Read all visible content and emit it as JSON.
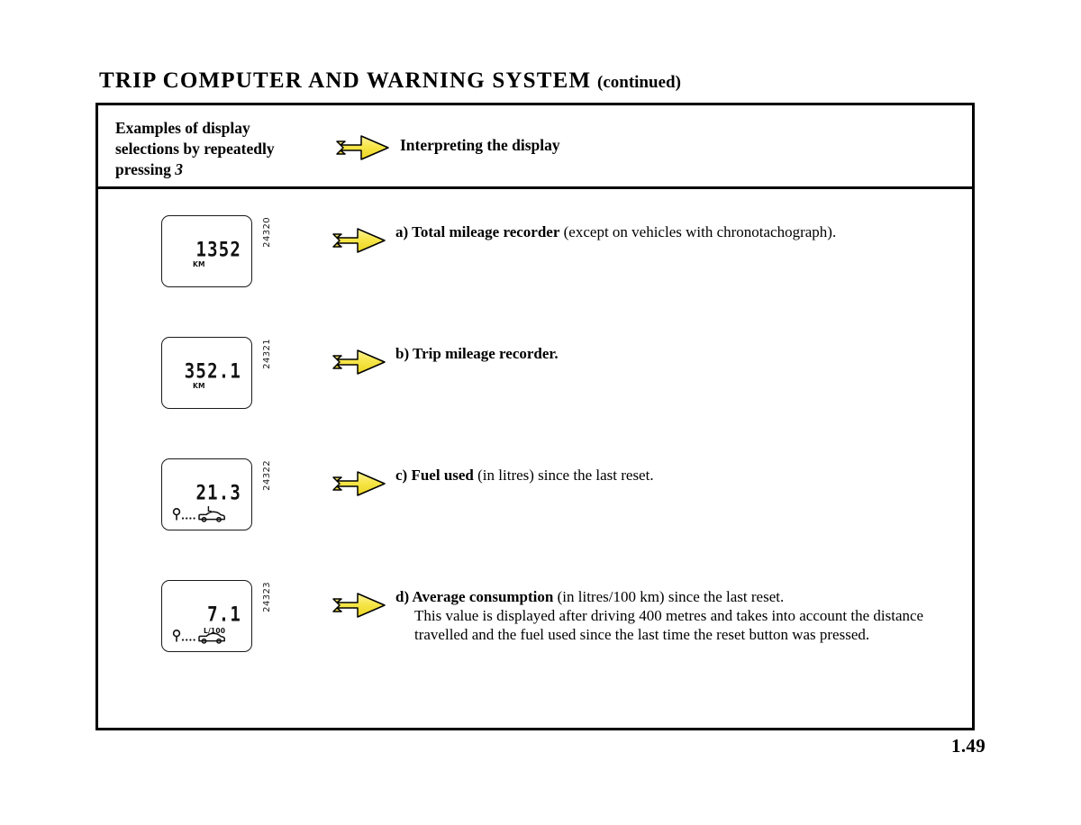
{
  "page": {
    "title_main": "TRIP COMPUTER AND WARNING SYSTEM",
    "title_continued": "(continued)",
    "number": "1.49"
  },
  "header": {
    "left_label_line1": "Examples of display",
    "left_label_line2": "selections by repeatedly",
    "left_label_line3_prefix": "pressing",
    "left_label_button_ref": "3",
    "arrow_icon": "yellow-right-arrow-icon",
    "right_label": "Interpreting the display"
  },
  "entries": [
    {
      "ref": "24320",
      "display": {
        "value": "1352",
        "unit": "KM",
        "unit_class": "unit-km",
        "pictogram": false
      },
      "arrow_icon": "yellow-right-arrow-icon",
      "lead": "a) Total mileage recorder",
      "tail": " (except on vehicles with chronotachograph).",
      "extra": ""
    },
    {
      "ref": "24321",
      "display": {
        "value": "352.1",
        "unit": "KM",
        "unit_class": "unit-km",
        "pictogram": false
      },
      "arrow_icon": "yellow-right-arrow-icon",
      "lead": "b) Trip mileage recorder.",
      "tail": "",
      "extra": ""
    },
    {
      "ref": "24322",
      "display": {
        "value": "21.3",
        "unit": "L",
        "unit_class": "unit-l",
        "pictogram": true
      },
      "arrow_icon": "yellow-right-arrow-icon",
      "lead": "c) Fuel used",
      "tail": " (in litres) since the last reset.",
      "extra": ""
    },
    {
      "ref": "24323",
      "display": {
        "value": "7.1",
        "unit": "L/100",
        "unit_class": "unit-l100",
        "pictogram": true
      },
      "arrow_icon": "yellow-right-arrow-icon",
      "lead": "d) Average consumption",
      "tail": " (in litres/100 km) since the last reset.",
      "extra": "This value is displayed after driving 400 metres and takes into account the distance travelled and the fuel used since the last time the reset button was pressed."
    }
  ],
  "colors": {
    "arrow_fill": "#f5e03c",
    "arrow_fill_light": "#fdf49a",
    "outline": "#000000",
    "paper": "#ffffff"
  }
}
